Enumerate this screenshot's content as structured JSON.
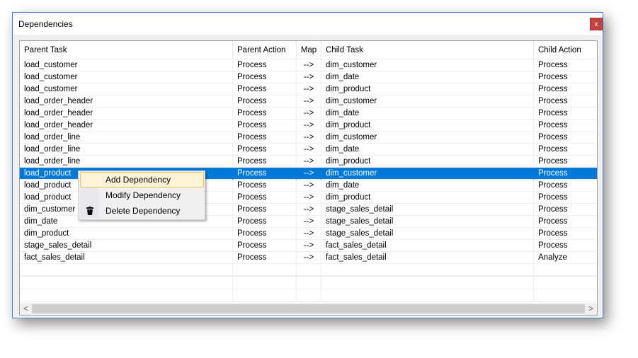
{
  "window": {
    "title": "Dependencies",
    "close_label": "x"
  },
  "columns": [
    "Parent Task",
    "Parent Action",
    "Map",
    "Child Task",
    "Child Action"
  ],
  "rows": [
    [
      "load_customer",
      "Process",
      "-->",
      "dim_customer",
      "Process"
    ],
    [
      "load_customer",
      "Process",
      "-->",
      "dim_date",
      "Process"
    ],
    [
      "load_customer",
      "Process",
      "-->",
      "dim_product",
      "Process"
    ],
    [
      "load_order_header",
      "Process",
      "-->",
      "dim_customer",
      "Process"
    ],
    [
      "load_order_header",
      "Process",
      "-->",
      "dim_date",
      "Process"
    ],
    [
      "load_order_header",
      "Process",
      "-->",
      "dim_product",
      "Process"
    ],
    [
      "load_order_line",
      "Process",
      "-->",
      "dim_customer",
      "Process"
    ],
    [
      "load_order_line",
      "Process",
      "-->",
      "dim_date",
      "Process"
    ],
    [
      "load_order_line",
      "Process",
      "-->",
      "dim_product",
      "Process"
    ],
    [
      "load_product",
      "Process",
      "-->",
      "dim_customer",
      "Process"
    ],
    [
      "load_product",
      "Process",
      "-->",
      "dim_date",
      "Process"
    ],
    [
      "load_product",
      "Process",
      "-->",
      "dim_product",
      "Process"
    ],
    [
      "dim_customer",
      "Process",
      "-->",
      "stage_sales_detail",
      "Process"
    ],
    [
      "dim_date",
      "Process",
      "-->",
      "stage_sales_detail",
      "Process"
    ],
    [
      "dim_product",
      "Process",
      "-->",
      "stage_sales_detail",
      "Process"
    ],
    [
      "stage_sales_detail",
      "Process",
      "-->",
      "fact_sales_detail",
      "Process"
    ],
    [
      "fact_sales_detail",
      "Process",
      "-->",
      "fact_sales_detail",
      "Analyze"
    ]
  ],
  "selected_row": 9,
  "context_menu": {
    "items": [
      {
        "label": "Add Dependency",
        "icon": ""
      },
      {
        "label": "Modify Dependency",
        "icon": ""
      },
      {
        "label": "Delete Dependency",
        "icon": "trash-icon"
      }
    ]
  },
  "scrollbar": {
    "left": "<",
    "right": ">"
  }
}
